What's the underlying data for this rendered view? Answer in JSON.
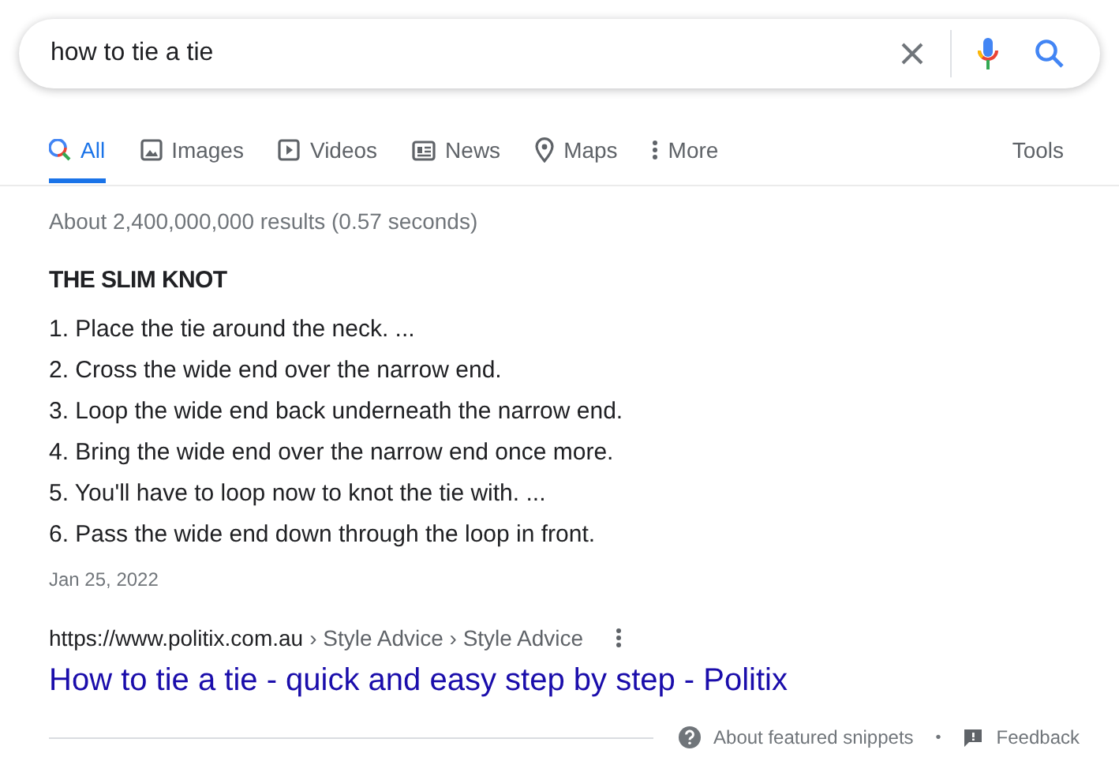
{
  "search": {
    "value": "how to tie a tie"
  },
  "tabs": [
    {
      "label": "All",
      "kind": "all",
      "selected": true
    },
    {
      "label": "Images",
      "kind": "images",
      "selected": false
    },
    {
      "label": "Videos",
      "kind": "videos",
      "selected": false
    },
    {
      "label": "News",
      "kind": "news",
      "selected": false
    },
    {
      "label": "Maps",
      "kind": "maps",
      "selected": false
    },
    {
      "label": "More",
      "kind": "more",
      "selected": false
    }
  ],
  "tools": "Tools",
  "result_stats": "About 2,400,000,000 results (0.57 seconds)",
  "snippet": {
    "heading": "THE SLIM KNOT",
    "steps": [
      "1. Place the tie around the neck. ...",
      "2. Cross the wide end over the narrow end.",
      "3. Loop the wide end back underneath the narrow end.",
      "4. Bring the wide end over the narrow end once more.",
      "5. You'll have to loop now to knot the tie with. ...",
      "6. Pass the wide end down through the loop in front."
    ],
    "date": "Jan 25, 2022"
  },
  "result": {
    "url": "https://www.politix.com.au",
    "breadcrumb": "› Style Advice › Style Advice",
    "title": "How to tie a tie - quick and easy step by step - Politix"
  },
  "footer": {
    "about": "About featured snippets",
    "separator": "•",
    "feedback": "Feedback"
  }
}
